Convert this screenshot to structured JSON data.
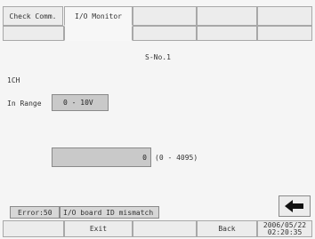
{
  "tabs": [
    {
      "label": "Check Comm."
    },
    {
      "label": "I/O Monitor"
    },
    {
      "label": ""
    },
    {
      "label": ""
    },
    {
      "label": ""
    }
  ],
  "header": {
    "station": "S-No.1"
  },
  "channel": "1CH",
  "range": {
    "label": "In Range",
    "value": "0 - 10V"
  },
  "reading": {
    "value": "0",
    "range_note": "(0 - 4095)"
  },
  "status": {
    "code": "Error:50",
    "message": "I/O board ID mismatch"
  },
  "footer": {
    "exit_label": "Exit",
    "back_label": "Back",
    "date": "2006/05/22",
    "time": "02:20:35"
  },
  "icons": {
    "back_arrow": "left-arrow-icon"
  },
  "colors": {
    "background": "#f5f5f5",
    "field": "#c9c9c9",
    "button": "#ececec"
  }
}
